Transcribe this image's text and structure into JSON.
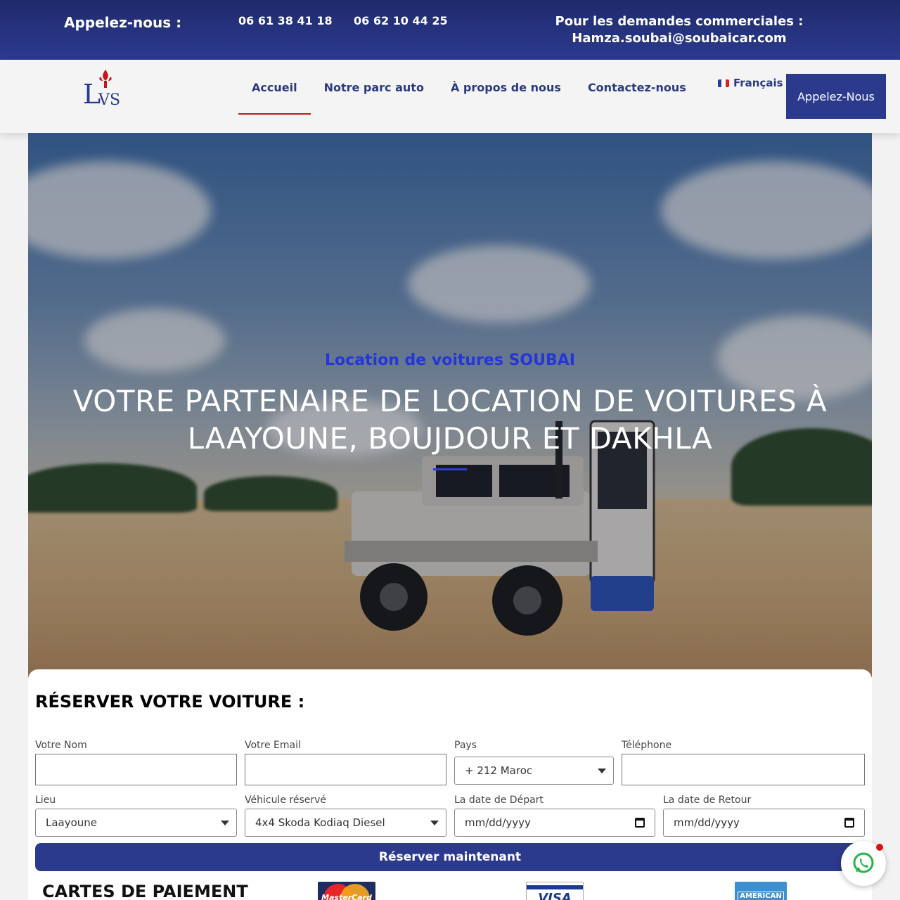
{
  "topbar": {
    "call_label": "Appelez-nous :",
    "phone1": "06 61 38 41 18",
    "phone2": "06 62 10 44 25",
    "commercial_label": "Pour les demandes commerciales :",
    "email": "Hamza.soubai@soubaicar.com"
  },
  "header": {
    "logo_text": "LVS",
    "nav": [
      {
        "label": "Accueil",
        "active": true
      },
      {
        "label": "Notre parc auto"
      },
      {
        "label": "À propos de nous"
      },
      {
        "label": "Contactez-nous"
      }
    ],
    "language": "Français",
    "call_button": "Appelez-Nous"
  },
  "hero": {
    "subtitle": "Location de voitures SOUBAI",
    "title": "VOTRE PARTENAIRE DE LOCATION DE VOITURES À LAAYOUNE, BOUJDOUR ET DAKHLA"
  },
  "form": {
    "heading": "RÉSERVER VOTRE VOITURE :",
    "name_label": "Votre Nom",
    "email_label": "Votre Email",
    "country_label": "Pays",
    "country_value": "+ 212 Maroc",
    "phone_label": "Téléphone",
    "place_label": "Lieu",
    "place_value": "Laayoune",
    "vehicle_label": "Véhicule réservé",
    "vehicle_value": "4x4 Skoda Kodiaq Diesel",
    "departure_label": "La date de Départ",
    "departure_value": "mm/dd/yyyy",
    "return_label": "La date de Retour",
    "return_value": "mm/dd/yyyy",
    "submit": "Réserver maintenant"
  },
  "payment": {
    "title": "CARTES DE PAIEMENT",
    "mastercard": "MasterCard",
    "visa": "VISA",
    "amex": "AMERICAN"
  },
  "colors": {
    "primary": "#2b3a8c",
    "accent_red": "#c4161c",
    "hero_subtitle": "#2436d8"
  }
}
